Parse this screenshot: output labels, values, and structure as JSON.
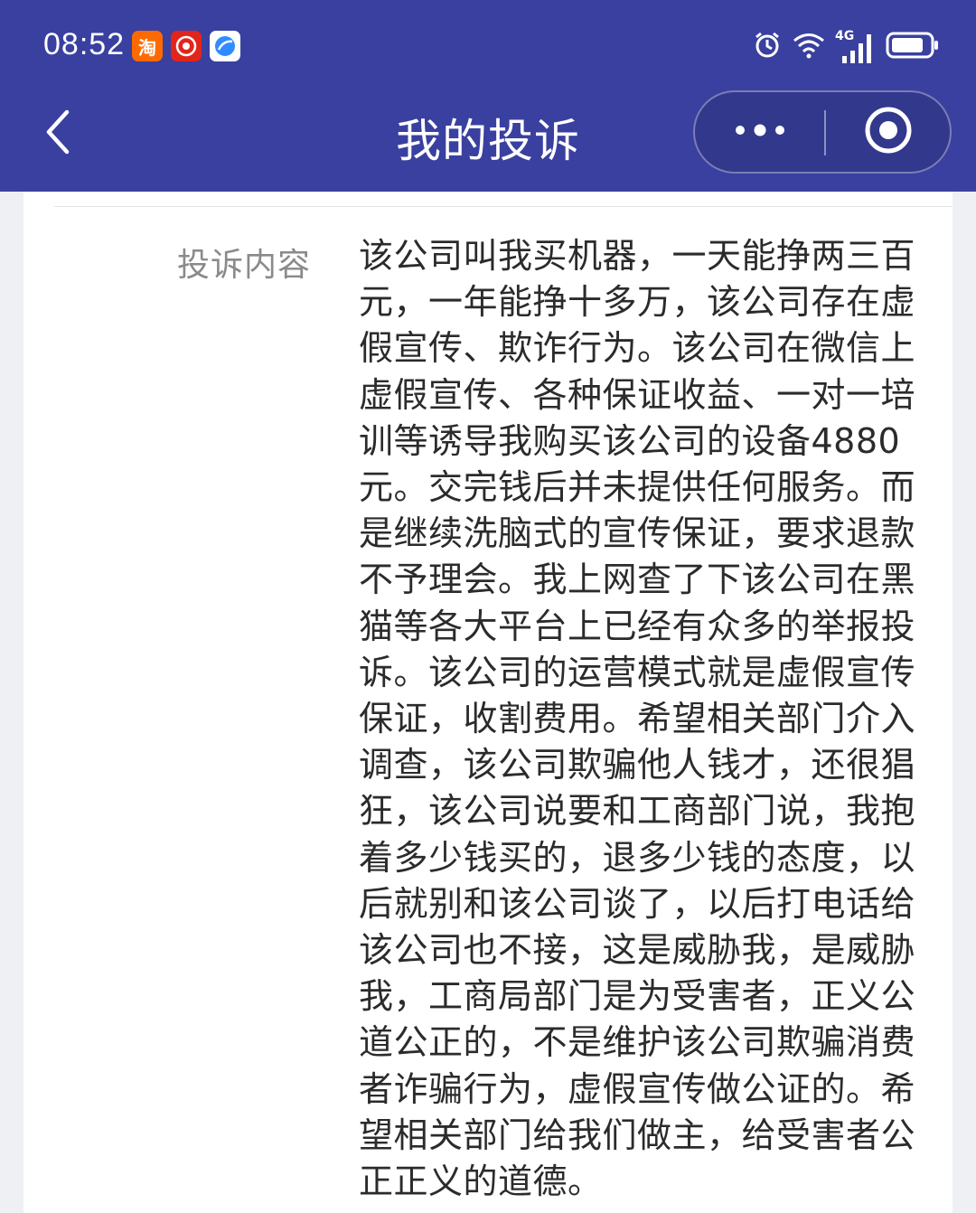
{
  "status_bar": {
    "time": "08:52",
    "network": "4G",
    "icons": [
      "taobao-app-icon",
      "jd-app-icon",
      "browser-app-icon",
      "alarm-icon",
      "wifi-icon",
      "signal-icon",
      "battery-icon"
    ]
  },
  "nav": {
    "title": "我的投诉",
    "back_icon": "chevron-left-icon",
    "more_icon": "more-dots-icon",
    "close_icon": "target-close-icon"
  },
  "complaint": {
    "label": "投诉内容",
    "content": "该公司叫我买机器，一天能挣两三百元，一年能挣十多万，该公司存在虚假宣传、欺诈行为。该公司在微信上虚假宣传、各种保证收益、一对一培训等诱导我购买该公司的设备4880元。交完钱后并未提供任何服务。而是继续洗脑式的宣传保证，要求退款不予理会。我上网查了下该公司在黑猫等各大平台上已经有众多的举报投诉。该公司的运营模式就是虚假宣传保证，收割费用。希望相关部门介入调查，该公司欺骗他人钱才，还很猖狂，该公司说要和工商部门说，我抱着多少钱买的，退多少钱的态度，以后就别和该公司谈了，以后打电话给该公司也不接，这是威胁我，是威胁我，工商局部门是为受害者，正义公道公正的，不是维护该公司欺骗消费者诈骗行为，虚假宣传做公证的。希望相关部门给我们做主，给受害者公正正义的道德。"
  },
  "colors": {
    "header_bg": "#3a40a0",
    "page_bg": "#eef0f3",
    "label_text": "#8a8a8a",
    "content_text": "#2b2b2b"
  }
}
